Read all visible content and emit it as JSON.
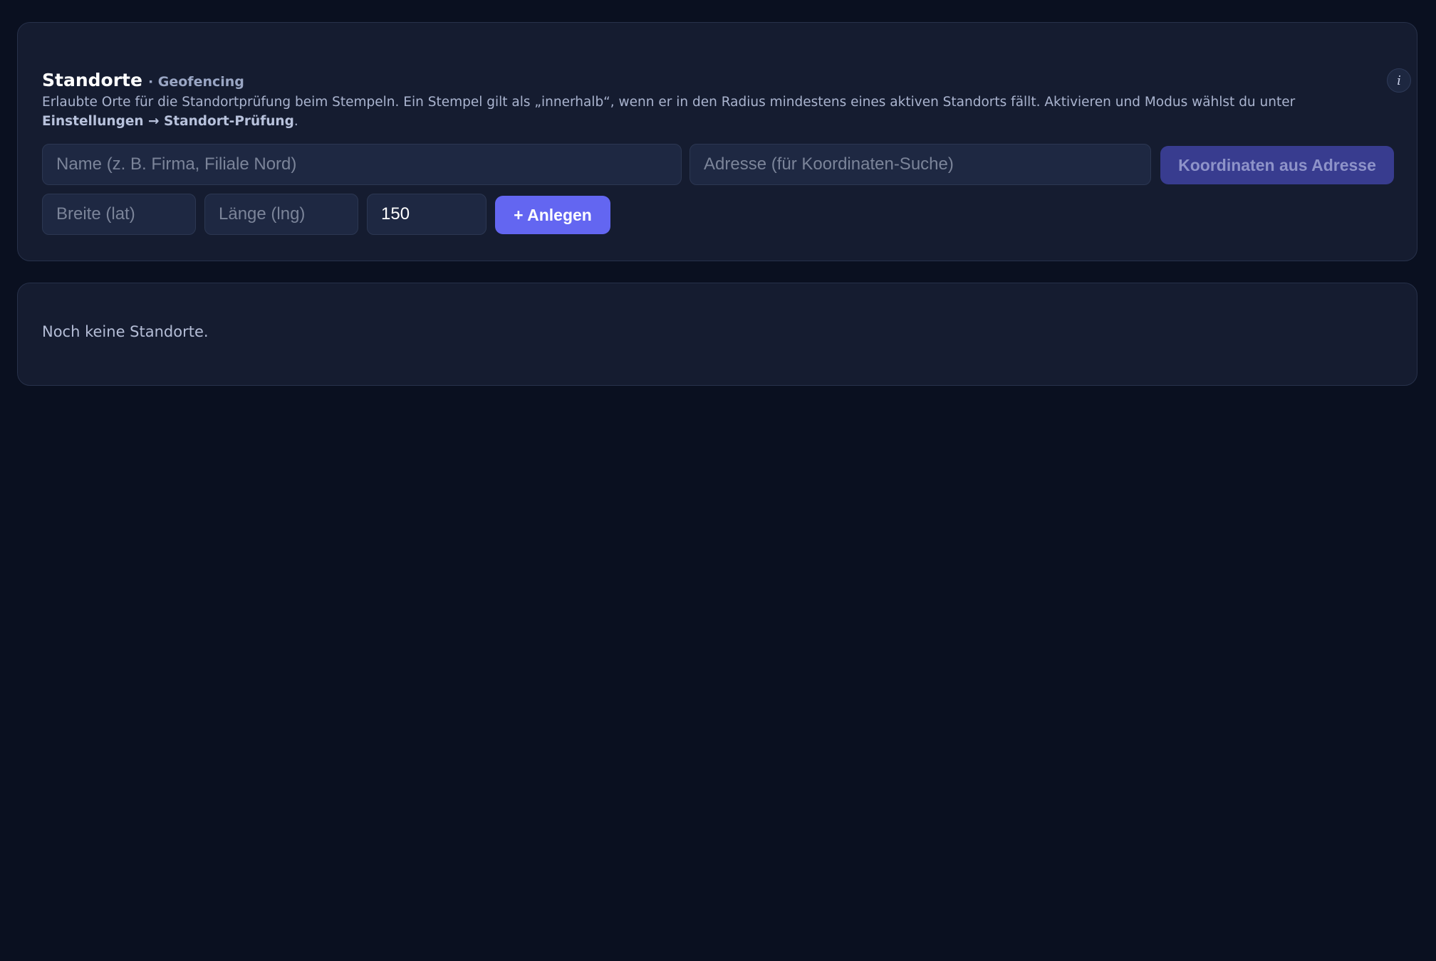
{
  "header": {
    "title": "Standorte",
    "subtitle": "· Geofencing",
    "info_label": "i"
  },
  "description": {
    "text": "Erlaubte Orte für die Standortprüfung beim Stempeln. Ein Stempel gilt als „innerhalb“, wenn er in den Radius mindestens eines aktiven Standorts fällt. Aktivieren und Modus wählst du unter ",
    "link_settings": "Einstellungen",
    "arrow": " → ",
    "link_check": "Standort-Prüfung",
    "end": "."
  },
  "form": {
    "name_placeholder": "Name (z. B. Firma, Filiale Nord)",
    "name_value": "",
    "address_placeholder": "Adresse (für Koordinaten-Suche)",
    "address_value": "",
    "geocode_button": "Koordinaten aus Adresse",
    "lat_placeholder": "Breite (lat)",
    "lat_value": "",
    "lng_placeholder": "Länge (lng)",
    "lng_value": "",
    "radius_value": "150",
    "add_button": "+ Anlegen"
  },
  "list": {
    "empty_text": "Noch keine Standorte."
  },
  "colors": {
    "background": "#0a1020",
    "card": "#151c30",
    "accent": "#6366f1",
    "accent_disabled": "#383c8f"
  }
}
